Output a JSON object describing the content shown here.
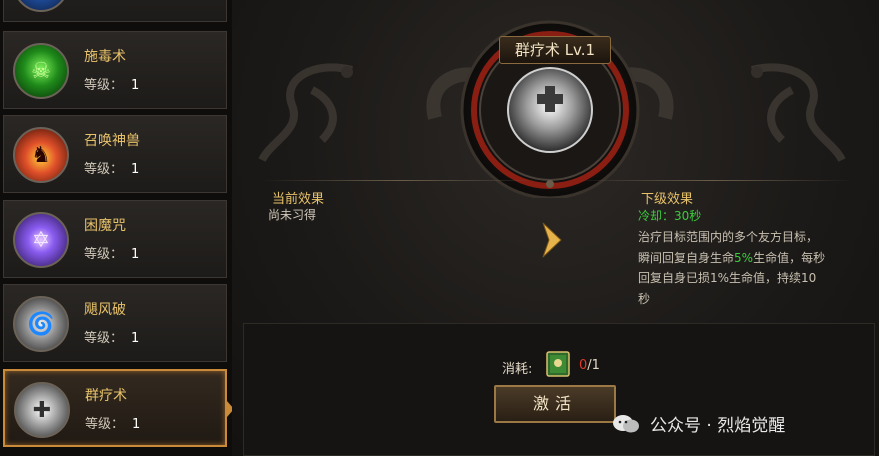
{
  "sidebar": {
    "level_label": "等级：",
    "items": [
      {
        "name": "施毒术",
        "level": "1",
        "icon": "poison-skill-icon",
        "color": "#3fbf3a"
      },
      {
        "name": "召唤神兽",
        "level": "1",
        "icon": "summon-beast-skill-icon",
        "color": "#e0502a"
      },
      {
        "name": "困魔咒",
        "level": "1",
        "icon": "trap-spell-skill-icon",
        "color": "#8a5cf0"
      },
      {
        "name": "飓风破",
        "level": "1",
        "icon": "hurricane-skill-icon",
        "color": "#bcbcbc"
      },
      {
        "name": "群疗术",
        "level": "1",
        "icon": "group-heal-skill-icon",
        "color": "#d0d0d0"
      }
    ]
  },
  "detail": {
    "title": "群疗术 Lv.1",
    "current_effect": {
      "title": "当前效果",
      "body": "尚未习得"
    },
    "next_effect": {
      "title": "下级效果",
      "cooldown": "冷却：30秒",
      "desc_line1": "治疗目标范围内的多个友方目标，",
      "desc_line2a": "瞬间回复自身生命",
      "desc_line2b": "5%",
      "desc_line2c": "生命值，每秒",
      "desc_line3": "回复自身已损1%生命值，持续10",
      "desc_line4": "秒"
    }
  },
  "cost": {
    "label": "消耗:",
    "have": "0",
    "need": "/1",
    "item_icon": "skill-book-icon"
  },
  "activate_label": "激活",
  "watermark": "公众号 · 烈焰觉醒"
}
